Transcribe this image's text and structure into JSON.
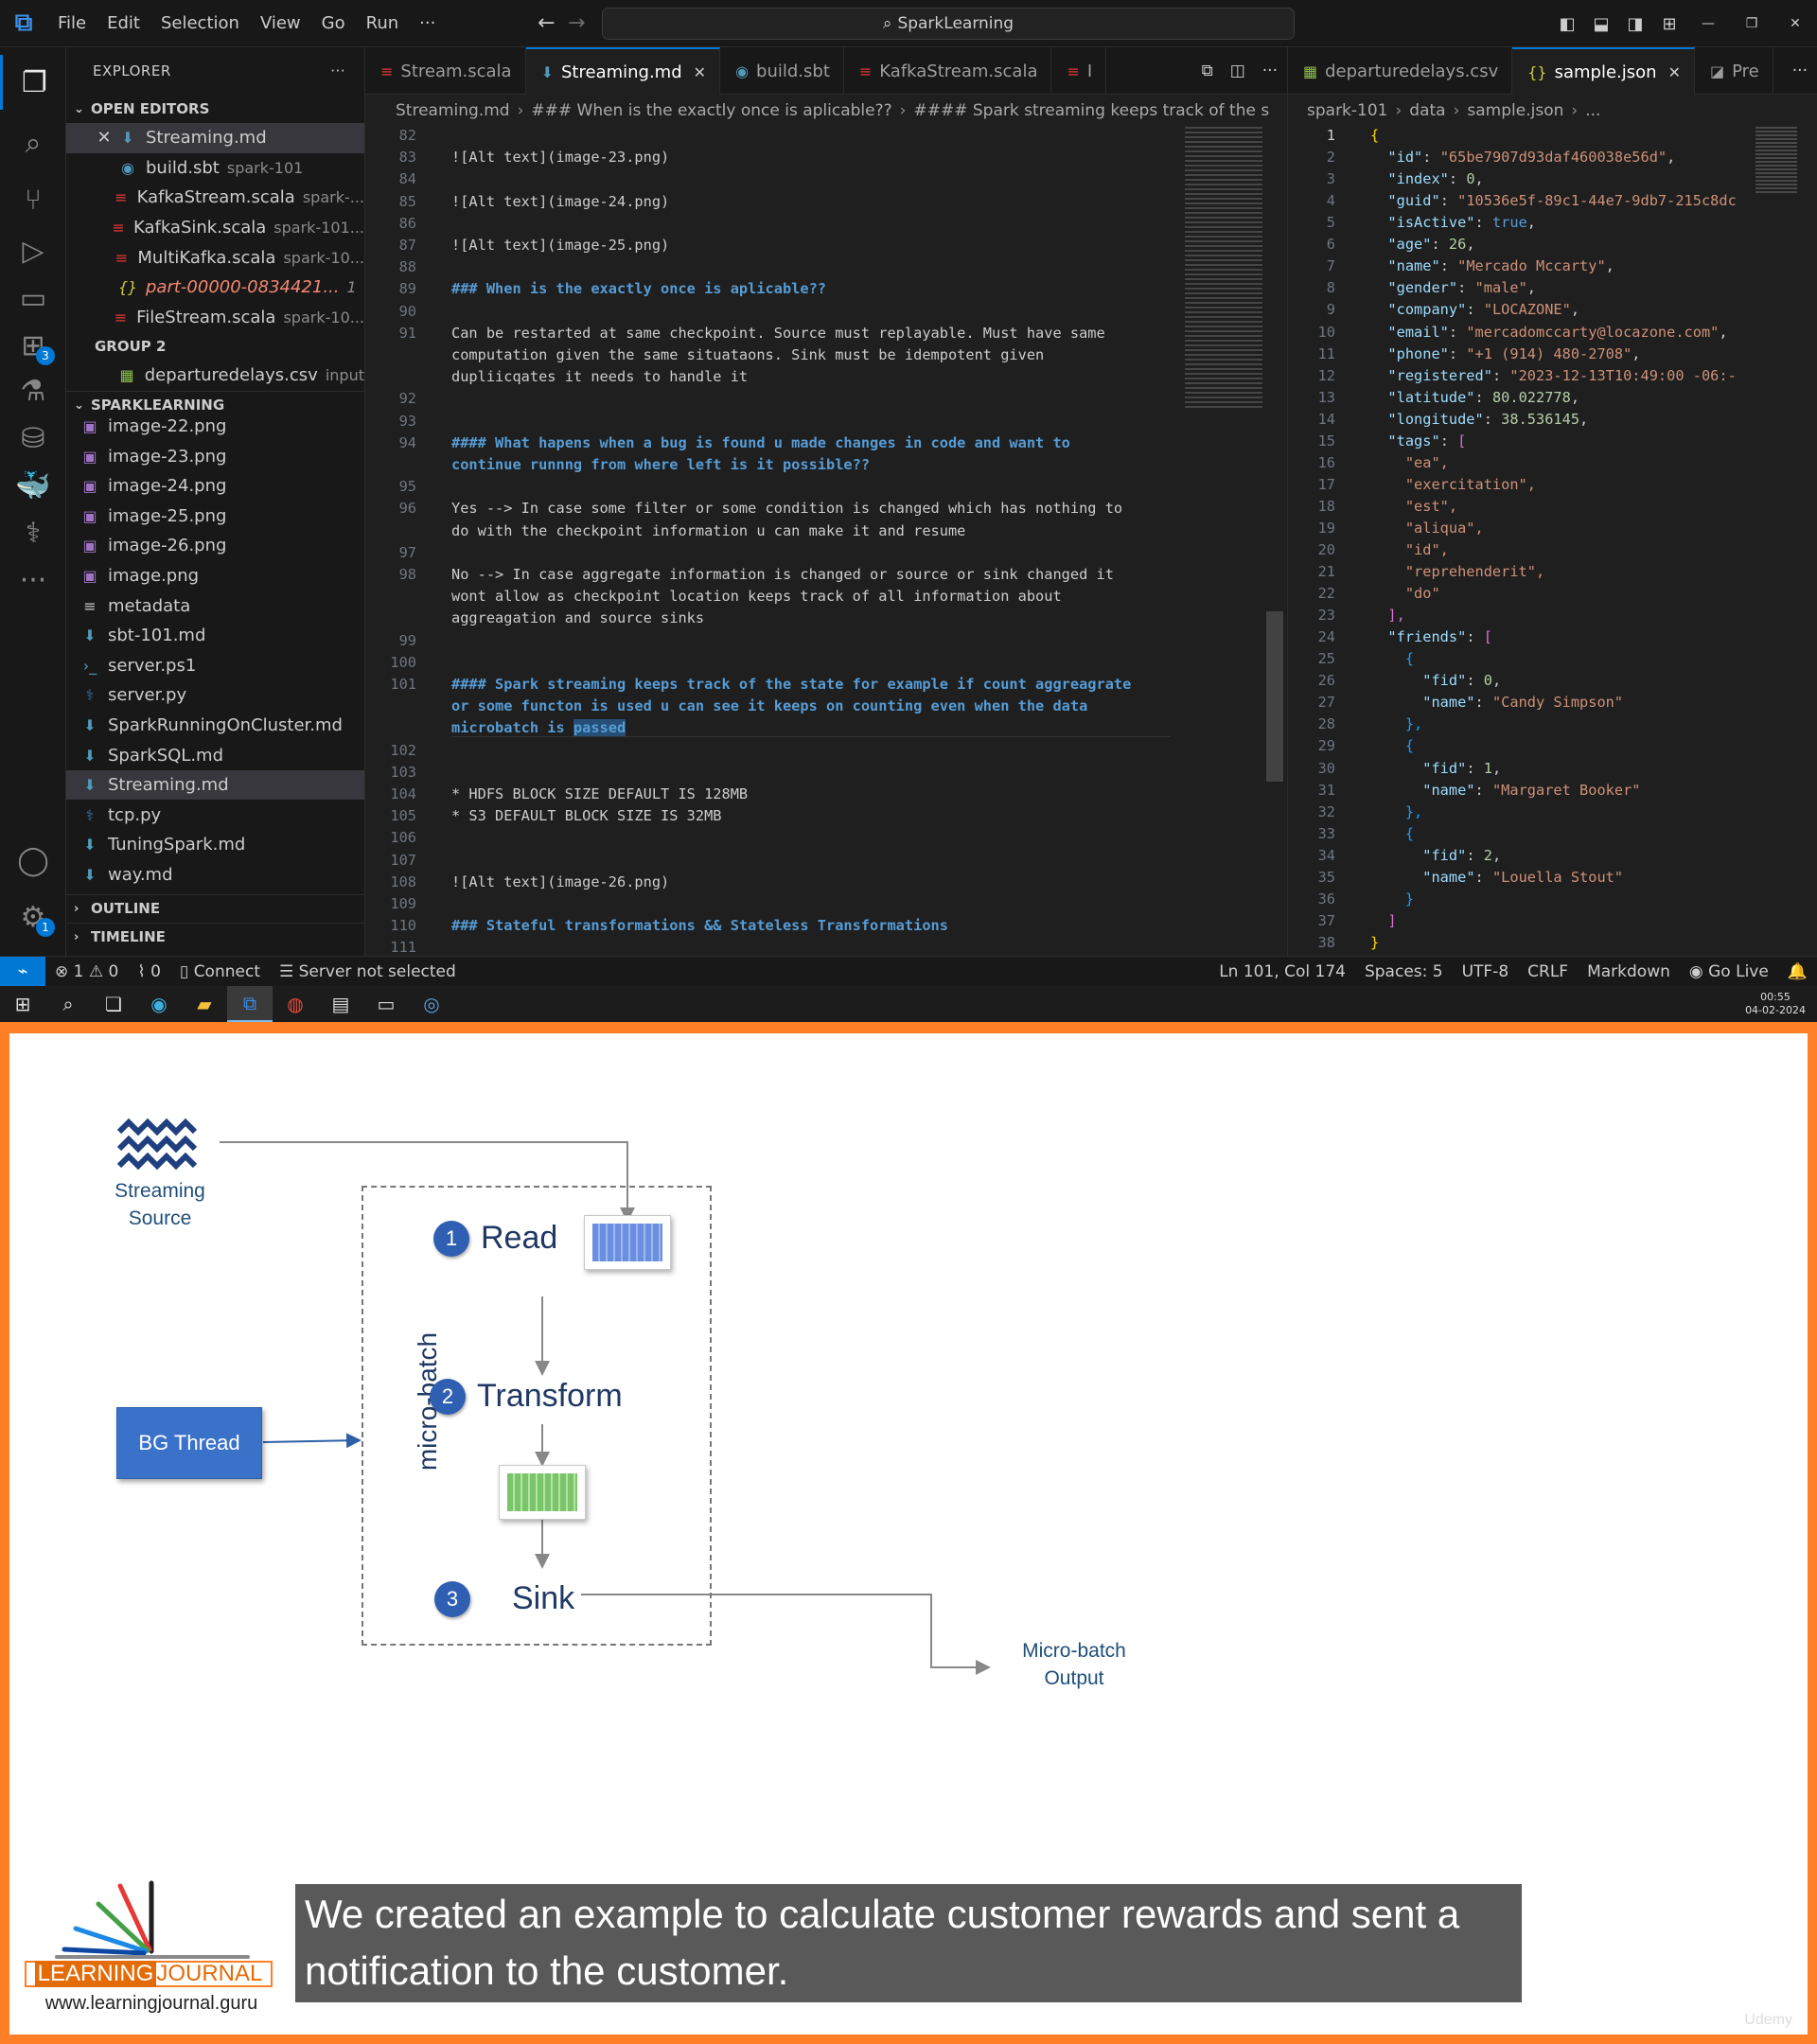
{
  "titlebar": {
    "menu": [
      "File",
      "Edit",
      "Selection",
      "View",
      "Go",
      "Run"
    ],
    "more": "···",
    "search": "SparkLearning"
  },
  "sidebar": {
    "title": "EXPLORER",
    "more": "···",
    "open_editors_label": "OPEN EDITORS",
    "open_editors": [
      {
        "name": "Streaming.md",
        "desc": "",
        "type": "md",
        "selected": true,
        "close": true
      },
      {
        "name": "build.sbt",
        "desc": "spark-101",
        "type": "sbt"
      },
      {
        "name": "KafkaStream.scala",
        "desc": "spark-...",
        "type": "scala"
      },
      {
        "name": "KafkaSink.scala",
        "desc": "spark-101...",
        "type": "scala"
      },
      {
        "name": "MultiKafka.scala",
        "desc": "spark-10...",
        "type": "scala"
      },
      {
        "name": "part-00000-0834421...",
        "desc": "1",
        "type": "json",
        "error": true
      },
      {
        "name": "FileStream.scala",
        "desc": "spark-10...",
        "type": "scala"
      }
    ],
    "group2_label": "GROUP 2",
    "group2": [
      {
        "name": "departuredelays.csv",
        "desc": "input",
        "type": "csv"
      }
    ],
    "project_label": "SPARKLEARNING",
    "files": [
      {
        "name": "image-22.png",
        "type": "png"
      },
      {
        "name": "image-23.png",
        "type": "png"
      },
      {
        "name": "image-24.png",
        "type": "png"
      },
      {
        "name": "image-25.png",
        "type": "png"
      },
      {
        "name": "image-26.png",
        "type": "png"
      },
      {
        "name": "image.png",
        "type": "png"
      },
      {
        "name": "metadata",
        "type": "txt"
      },
      {
        "name": "sbt-101.md",
        "type": "md"
      },
      {
        "name": "server.ps1",
        "type": "ps"
      },
      {
        "name": "server.py",
        "type": "py"
      },
      {
        "name": "SparkRunningOnCluster.md",
        "type": "md"
      },
      {
        "name": "SparkSQL.md",
        "type": "md"
      },
      {
        "name": "Streaming.md",
        "type": "md",
        "selected": true
      },
      {
        "name": "tcp.py",
        "type": "py"
      },
      {
        "name": "TuningSpark.md",
        "type": "md"
      },
      {
        "name": "way.md",
        "type": "md"
      }
    ],
    "outline_label": "OUTLINE",
    "timeline_label": "TIMELINE"
  },
  "tabs_left": [
    {
      "name": "Stream.scala",
      "type": "scala"
    },
    {
      "name": "Streaming.md",
      "type": "md",
      "active": true
    },
    {
      "name": "build.sbt",
      "type": "sbt"
    },
    {
      "name": "KafkaStream.scala",
      "type": "scala"
    },
    {
      "name": "I",
      "type": "scala"
    }
  ],
  "tabs_right": [
    {
      "name": "departuredelays.csv",
      "type": "csv"
    },
    {
      "name": "sample.json",
      "type": "json",
      "active": true
    },
    {
      "name": "Pre",
      "type": "preview"
    }
  ],
  "breadcrumb_left": [
    "Streaming.md",
    "### When is the exactly once is aplicable??",
    "#### Spark streaming keeps track of the s"
  ],
  "breadcrumb_right": [
    "spark-101",
    "data",
    "sample.json",
    "..."
  ],
  "editor_left": {
    "lines": [
      {
        "n": "82",
        "t": ""
      },
      {
        "n": "83",
        "t": "![Alt text](image-23.png)",
        "kind": "img"
      },
      {
        "n": "84",
        "t": ""
      },
      {
        "n": "85",
        "t": "![Alt text](image-24.png)",
        "kind": "img"
      },
      {
        "n": "86",
        "t": ""
      },
      {
        "n": "87",
        "t": "![Alt text](image-25.png)",
        "kind": "img"
      },
      {
        "n": "88",
        "t": ""
      },
      {
        "n": "89",
        "t": "### When is the exactly once is aplicable??",
        "kind": "h"
      },
      {
        "n": "90",
        "t": ""
      },
      {
        "n": "91",
        "t": "Can be restarted at same checkpoint. Source must replayable. Must have same"
      },
      {
        "n": "",
        "t": "computation given the same situataons. Sink must be idempotent given"
      },
      {
        "n": "",
        "t": "dupliicqates it needs to handle it"
      },
      {
        "n": "92",
        "t": ""
      },
      {
        "n": "93",
        "t": ""
      },
      {
        "n": "94",
        "t": "#### What hapens when a bug is found u made changes in code and want to",
        "kind": "h"
      },
      {
        "n": "",
        "t": "continue runnng from where left is it possible??",
        "kind": "h"
      },
      {
        "n": "95",
        "t": ""
      },
      {
        "n": "96",
        "t": "Yes --> In case some filter or some condition is changed which has nothing to"
      },
      {
        "n": "",
        "t": "do with the checkpoint information u can make it and resume"
      },
      {
        "n": "97",
        "t": ""
      },
      {
        "n": "98",
        "t": "No --> In case aggregate information is changed or source or sink changed it"
      },
      {
        "n": "",
        "t": "wont allow as checkpoint location keeps track of all information about"
      },
      {
        "n": "",
        "t": "aggreagation and source sinks"
      },
      {
        "n": "99",
        "t": ""
      },
      {
        "n": "100",
        "t": ""
      },
      {
        "n": "101",
        "t": "#### Spark streaming keeps track of the state for example if count aggreagrate",
        "kind": "h"
      },
      {
        "n": "",
        "t": "or some functon is used u can see it keeps on counting even when the data",
        "kind": "h"
      },
      {
        "n": "",
        "t": "microbatch is passed",
        "kind": "hsel"
      },
      {
        "n": "102",
        "t": ""
      },
      {
        "n": "103",
        "t": ""
      },
      {
        "n": "104",
        "t": "* HDFS BLOCK SIZE DEFAULT IS 128MB",
        "kind": "li"
      },
      {
        "n": "105",
        "t": "* S3 DEFAULT BLOCK SIZE IS 32MB",
        "kind": "li"
      },
      {
        "n": "106",
        "t": ""
      },
      {
        "n": "107",
        "t": ""
      },
      {
        "n": "108",
        "t": "![Alt text](image-26.png)",
        "kind": "img"
      },
      {
        "n": "109",
        "t": ""
      },
      {
        "n": "110",
        "t": "### Stateful transformations && Stateless Transformations",
        "kind": "h"
      },
      {
        "n": "111",
        "t": ""
      }
    ]
  },
  "editor_right": {
    "lines": [
      {
        "n": "1",
        "t": "{"
      },
      {
        "n": "2",
        "k": "\"id\"",
        "v": "\"65be7907d93daf460038e56d\"",
        "vt": "s"
      },
      {
        "n": "3",
        "k": "\"index\"",
        "v": "0",
        "vt": "n"
      },
      {
        "n": "4",
        "k": "\"guid\"",
        "v": "\"10536e5f-89c1-44e7-9db7-215c8dc",
        "vt": "s",
        "nocomma": true
      },
      {
        "n": "5",
        "k": "\"isActive\"",
        "v": "true",
        "vt": "b"
      },
      {
        "n": "6",
        "k": "\"age\"",
        "v": "26",
        "vt": "n"
      },
      {
        "n": "7",
        "k": "\"name\"",
        "v": "\"Mercado Mccarty\"",
        "vt": "s"
      },
      {
        "n": "8",
        "k": "\"gender\"",
        "v": "\"male\"",
        "vt": "s"
      },
      {
        "n": "9",
        "k": "\"company\"",
        "v": "\"LOCAZONE\"",
        "vt": "s"
      },
      {
        "n": "10",
        "k": "\"email\"",
        "v": "\"mercadomccarty@locazone.com\"",
        "vt": "s"
      },
      {
        "n": "11",
        "k": "\"phone\"",
        "v": "\"+1 (914) 480-2708\"",
        "vt": "s"
      },
      {
        "n": "12",
        "k": "\"registered\"",
        "v": "\"2023-12-13T10:49:00 -06:-",
        "vt": "s",
        "nocomma": true
      },
      {
        "n": "13",
        "k": "\"latitude\"",
        "v": "80.022778",
        "vt": "n"
      },
      {
        "n": "14",
        "k": "\"longitude\"",
        "v": "38.536145",
        "vt": "n"
      },
      {
        "n": "15",
        "k": "\"tags\"",
        "v": "[",
        "vt": "p2",
        "nocomma": true
      },
      {
        "n": "16",
        "t": "    \"ea\",",
        "tt": "s"
      },
      {
        "n": "17",
        "t": "    \"exercitation\",",
        "tt": "s"
      },
      {
        "n": "18",
        "t": "    \"est\",",
        "tt": "s"
      },
      {
        "n": "19",
        "t": "    \"aliqua\",",
        "tt": "s"
      },
      {
        "n": "20",
        "t": "    \"id\",",
        "tt": "s"
      },
      {
        "n": "21",
        "t": "    \"reprehenderit\",",
        "tt": "s"
      },
      {
        "n": "22",
        "t": "    \"do\"",
        "tt": "s"
      },
      {
        "n": "23",
        "t": "  ],",
        "tt": "p2"
      },
      {
        "n": "24",
        "k": "\"friends\"",
        "v": "[",
        "vt": "p2",
        "nocomma": true
      },
      {
        "n": "25",
        "t": "    {",
        "tt": "p3"
      },
      {
        "n": "26",
        "k2": "\"fid\"",
        "v": "0",
        "vt": "n"
      },
      {
        "n": "27",
        "k2": "\"name\"",
        "v": "\"Candy Simpson\"",
        "vt": "s",
        "nocomma": true
      },
      {
        "n": "28",
        "t": "    },",
        "tt": "p3"
      },
      {
        "n": "29",
        "t": "    {",
        "tt": "p3"
      },
      {
        "n": "30",
        "k2": "\"fid\"",
        "v": "1",
        "vt": "n"
      },
      {
        "n": "31",
        "k2": "\"name\"",
        "v": "\"Margaret Booker\"",
        "vt": "s",
        "nocomma": true
      },
      {
        "n": "32",
        "t": "    },",
        "tt": "p3"
      },
      {
        "n": "33",
        "t": "    {",
        "tt": "p3"
      },
      {
        "n": "34",
        "k2": "\"fid\"",
        "v": "2",
        "vt": "n"
      },
      {
        "n": "35",
        "k2": "\"name\"",
        "v": "\"Louella Stout\"",
        "vt": "s",
        "nocomma": true
      },
      {
        "n": "36",
        "t": "    }",
        "tt": "p3"
      },
      {
        "n": "37",
        "t": "  ]",
        "tt": "p2"
      },
      {
        "n": "38",
        "t": "}",
        "tt": "p"
      }
    ]
  },
  "statusbar": {
    "errors": "1",
    "warnings": "0",
    "ports": "0",
    "connect": "Connect",
    "server": "Server not selected",
    "position": "Ln 101, Col 174",
    "spaces": "Spaces: 5",
    "encoding": "UTF-8",
    "eol": "CRLF",
    "language": "Markdown",
    "golive": "Go Live"
  },
  "taskbar": {
    "time": "00:55",
    "date": "04-02-2024"
  },
  "slide": {
    "source_label_1": "Streaming",
    "source_label_2": "Source",
    "step1_num": "1",
    "step1": "Read",
    "step2_num": "2",
    "step2": "Transform",
    "step3_num": "3",
    "step3": "Sink",
    "microbatch_label": "micro-batch",
    "bg_thread": "BG Thread",
    "output_1": "Micro-batch",
    "output_2": "Output",
    "caption": "We created an example to calculate customer rewards and sent a notification to the customer.",
    "logo_word1": "LEARNING",
    "logo_word2": "JOURNAL",
    "logo_url": "www.learningjournal.guru",
    "watermark": "Udemy"
  }
}
